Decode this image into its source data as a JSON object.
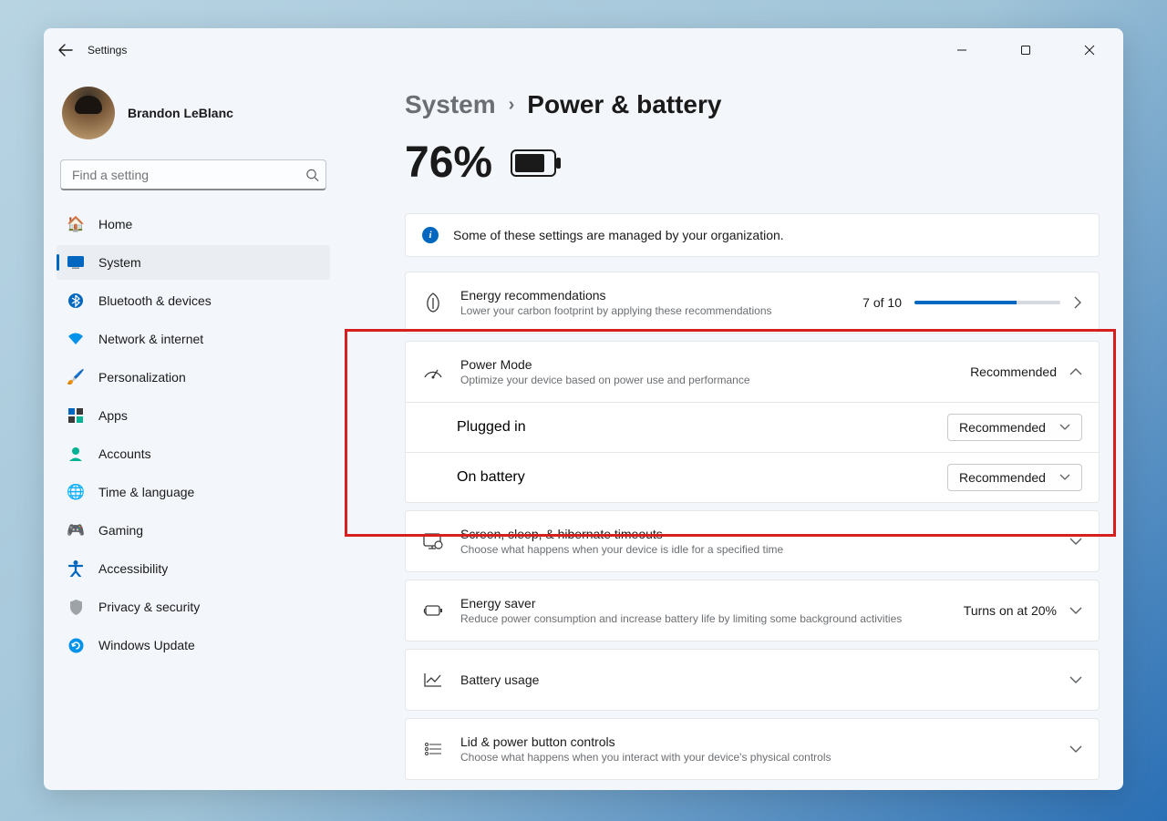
{
  "app": {
    "title": "Settings"
  },
  "user": {
    "name": "Brandon LeBlanc"
  },
  "search": {
    "placeholder": "Find a setting"
  },
  "nav": {
    "items": [
      {
        "label": "Home",
        "icon": "home"
      },
      {
        "label": "System",
        "icon": "system",
        "active": true
      },
      {
        "label": "Bluetooth & devices",
        "icon": "bluetooth"
      },
      {
        "label": "Network & internet",
        "icon": "wifi"
      },
      {
        "label": "Personalization",
        "icon": "personalization"
      },
      {
        "label": "Apps",
        "icon": "apps"
      },
      {
        "label": "Accounts",
        "icon": "accounts"
      },
      {
        "label": "Time & language",
        "icon": "time"
      },
      {
        "label": "Gaming",
        "icon": "gaming"
      },
      {
        "label": "Accessibility",
        "icon": "accessibility"
      },
      {
        "label": "Privacy & security",
        "icon": "privacy"
      },
      {
        "label": "Windows Update",
        "icon": "update"
      }
    ]
  },
  "breadcrumb": {
    "parent": "System",
    "current": "Power & battery"
  },
  "battery": {
    "percent": "76%"
  },
  "banner": {
    "text": "Some of these settings are managed by your organization."
  },
  "energy": {
    "title": "Energy recommendations",
    "sub": "Lower your carbon footprint by applying these recommendations",
    "count": "7 of 10",
    "progress_pct": 70
  },
  "powermode": {
    "title": "Power Mode",
    "sub": "Optimize your device based on power use and performance",
    "value": "Recommended",
    "plugged_label": "Plugged in",
    "plugged_value": "Recommended",
    "battery_label": "On battery",
    "battery_value": "Recommended"
  },
  "timeouts": {
    "title": "Screen, sleep, & hibernate timeouts",
    "sub": "Choose what happens when your device is idle for a specified time"
  },
  "energysaver": {
    "title": "Energy saver",
    "sub": "Reduce power consumption and increase battery life by limiting some background activities",
    "value": "Turns on at 20%"
  },
  "batteryusage": {
    "title": "Battery usage"
  },
  "lidpower": {
    "title": "Lid & power button controls",
    "sub": "Choose what happens when you interact with your device's physical controls"
  }
}
